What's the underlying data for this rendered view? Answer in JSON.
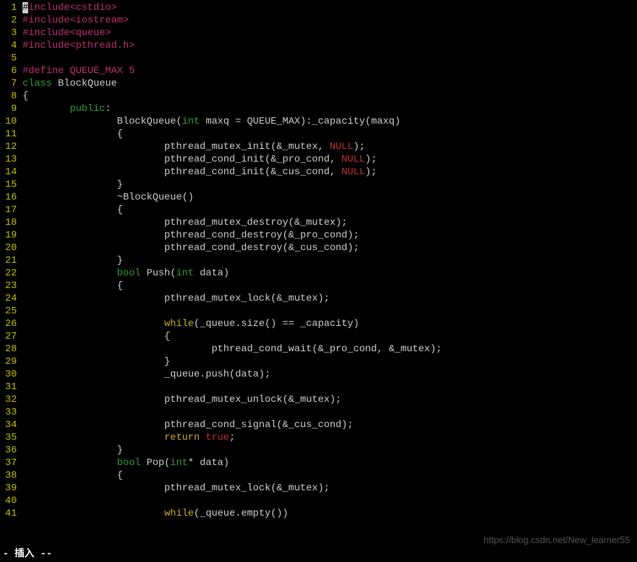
{
  "lines": [
    {
      "n": 1,
      "tokens": [
        {
          "t": "#",
          "c": "tok-preproc cursor"
        },
        {
          "t": "include",
          "c": "tok-preproc"
        },
        {
          "t": "<cstdio>",
          "c": "tok-include-angle"
        }
      ]
    },
    {
      "n": 2,
      "tokens": [
        {
          "t": "#include",
          "c": "tok-preproc"
        },
        {
          "t": "<iostream>",
          "c": "tok-include-angle"
        }
      ]
    },
    {
      "n": 3,
      "tokens": [
        {
          "t": "#include",
          "c": "tok-preproc"
        },
        {
          "t": "<queue>",
          "c": "tok-include-angle"
        }
      ]
    },
    {
      "n": 4,
      "tokens": [
        {
          "t": "#include",
          "c": "tok-preproc"
        },
        {
          "t": "<pthread.h>",
          "c": "tok-include-angle"
        }
      ]
    },
    {
      "n": 5,
      "tokens": []
    },
    {
      "n": 6,
      "tokens": [
        {
          "t": "#define QUEUE_MAX 5",
          "c": "tok-preproc"
        }
      ]
    },
    {
      "n": 7,
      "tokens": [
        {
          "t": "class",
          "c": "tok-class"
        },
        {
          "t": " BlockQueue",
          "c": "tok-ident"
        }
      ]
    },
    {
      "n": 8,
      "tokens": [
        {
          "t": "{",
          "c": "tok-brace"
        }
      ]
    },
    {
      "n": 9,
      "tokens": [
        {
          "t": "        ",
          "c": ""
        },
        {
          "t": "public",
          "c": "tok-public"
        },
        {
          "t": ":",
          "c": "tok-ident"
        }
      ]
    },
    {
      "n": 10,
      "tokens": [
        {
          "t": "                BlockQueue(",
          "c": "tok-ident"
        },
        {
          "t": "int",
          "c": "tok-type"
        },
        {
          "t": " maxq = QUEUE_MAX):_capacity(maxq)",
          "c": "tok-ident"
        }
      ]
    },
    {
      "n": 11,
      "tokens": [
        {
          "t": "                {",
          "c": "tok-brace"
        }
      ]
    },
    {
      "n": 12,
      "tokens": [
        {
          "t": "                        pthread_mutex_init(&_mutex, ",
          "c": "tok-ident"
        },
        {
          "t": "NULL",
          "c": "tok-null"
        },
        {
          "t": ");",
          "c": "tok-ident"
        }
      ]
    },
    {
      "n": 13,
      "tokens": [
        {
          "t": "                        pthread_cond_init(&_pro_cond, ",
          "c": "tok-ident"
        },
        {
          "t": "NULL",
          "c": "tok-null"
        },
        {
          "t": ");",
          "c": "tok-ident"
        }
      ]
    },
    {
      "n": 14,
      "tokens": [
        {
          "t": "                        pthread_cond_init(&_cus_cond, ",
          "c": "tok-ident"
        },
        {
          "t": "NULL",
          "c": "tok-null"
        },
        {
          "t": ");",
          "c": "tok-ident"
        }
      ]
    },
    {
      "n": 15,
      "tokens": [
        {
          "t": "                }",
          "c": "tok-brace"
        }
      ]
    },
    {
      "n": 16,
      "tokens": [
        {
          "t": "                ~BlockQueue()",
          "c": "tok-ident"
        }
      ]
    },
    {
      "n": 17,
      "tokens": [
        {
          "t": "                {",
          "c": "tok-brace"
        }
      ]
    },
    {
      "n": 18,
      "tokens": [
        {
          "t": "                        pthread_mutex_destroy(&_mutex);",
          "c": "tok-ident"
        }
      ]
    },
    {
      "n": 19,
      "tokens": [
        {
          "t": "                        pthread_cond_destroy(&_pro_cond);",
          "c": "tok-ident"
        }
      ]
    },
    {
      "n": 20,
      "tokens": [
        {
          "t": "                        pthread_cond_destroy(&_cus_cond);",
          "c": "tok-ident"
        }
      ]
    },
    {
      "n": 21,
      "tokens": [
        {
          "t": "                }",
          "c": "tok-brace"
        }
      ]
    },
    {
      "n": 22,
      "tokens": [
        {
          "t": "                ",
          "c": ""
        },
        {
          "t": "bool",
          "c": "tok-bool"
        },
        {
          "t": " Push(",
          "c": "tok-ident"
        },
        {
          "t": "int",
          "c": "tok-type"
        },
        {
          "t": " data)",
          "c": "tok-ident"
        }
      ]
    },
    {
      "n": 23,
      "tokens": [
        {
          "t": "                {",
          "c": "tok-brace"
        }
      ]
    },
    {
      "n": 24,
      "tokens": [
        {
          "t": "                        pthread_mutex_lock(&_mutex);",
          "c": "tok-ident"
        }
      ]
    },
    {
      "n": 25,
      "tokens": []
    },
    {
      "n": 26,
      "tokens": [
        {
          "t": "                        ",
          "c": ""
        },
        {
          "t": "while",
          "c": "tok-while"
        },
        {
          "t": "(_queue.size() == _capacity)",
          "c": "tok-ident"
        }
      ]
    },
    {
      "n": 27,
      "tokens": [
        {
          "t": "                        {",
          "c": "tok-brace"
        }
      ]
    },
    {
      "n": 28,
      "tokens": [
        {
          "t": "                                pthread_cond_wait(&_pro_cond, &_mutex);",
          "c": "tok-ident"
        }
      ]
    },
    {
      "n": 29,
      "tokens": [
        {
          "t": "                        }",
          "c": "tok-brace"
        }
      ]
    },
    {
      "n": 30,
      "tokens": [
        {
          "t": "                        _queue.push(data);",
          "c": "tok-ident"
        }
      ]
    },
    {
      "n": 31,
      "tokens": []
    },
    {
      "n": 32,
      "tokens": [
        {
          "t": "                        pthread_mutex_unlock(&_mutex);",
          "c": "tok-ident"
        }
      ]
    },
    {
      "n": 33,
      "tokens": []
    },
    {
      "n": 34,
      "tokens": [
        {
          "t": "                        pthread_cond_signal(&_cus_cond);",
          "c": "tok-ident"
        }
      ]
    },
    {
      "n": 35,
      "tokens": [
        {
          "t": "                        ",
          "c": ""
        },
        {
          "t": "return",
          "c": "tok-return"
        },
        {
          "t": " ",
          "c": ""
        },
        {
          "t": "true",
          "c": "tok-true"
        },
        {
          "t": ";",
          "c": "tok-ident"
        }
      ]
    },
    {
      "n": 36,
      "tokens": [
        {
          "t": "                }",
          "c": "tok-brace"
        }
      ]
    },
    {
      "n": 37,
      "tokens": [
        {
          "t": "                ",
          "c": ""
        },
        {
          "t": "bool",
          "c": "tok-bool"
        },
        {
          "t": " Pop(",
          "c": "tok-ident"
        },
        {
          "t": "int",
          "c": "tok-type"
        },
        {
          "t": "* data)",
          "c": "tok-ident"
        }
      ]
    },
    {
      "n": 38,
      "tokens": [
        {
          "t": "                {",
          "c": "tok-brace"
        }
      ]
    },
    {
      "n": 39,
      "tokens": [
        {
          "t": "                        pthread_mutex_lock(&_mutex);",
          "c": "tok-ident"
        }
      ]
    },
    {
      "n": 40,
      "tokens": []
    },
    {
      "n": 41,
      "tokens": [
        {
          "t": "                        ",
          "c": ""
        },
        {
          "t": "while",
          "c": "tok-while"
        },
        {
          "t": "(_queue.empty())",
          "c": "tok-ident"
        }
      ]
    }
  ],
  "status": "- 插入 --",
  "watermark": "https://blog.csdn.net/New_learner55"
}
